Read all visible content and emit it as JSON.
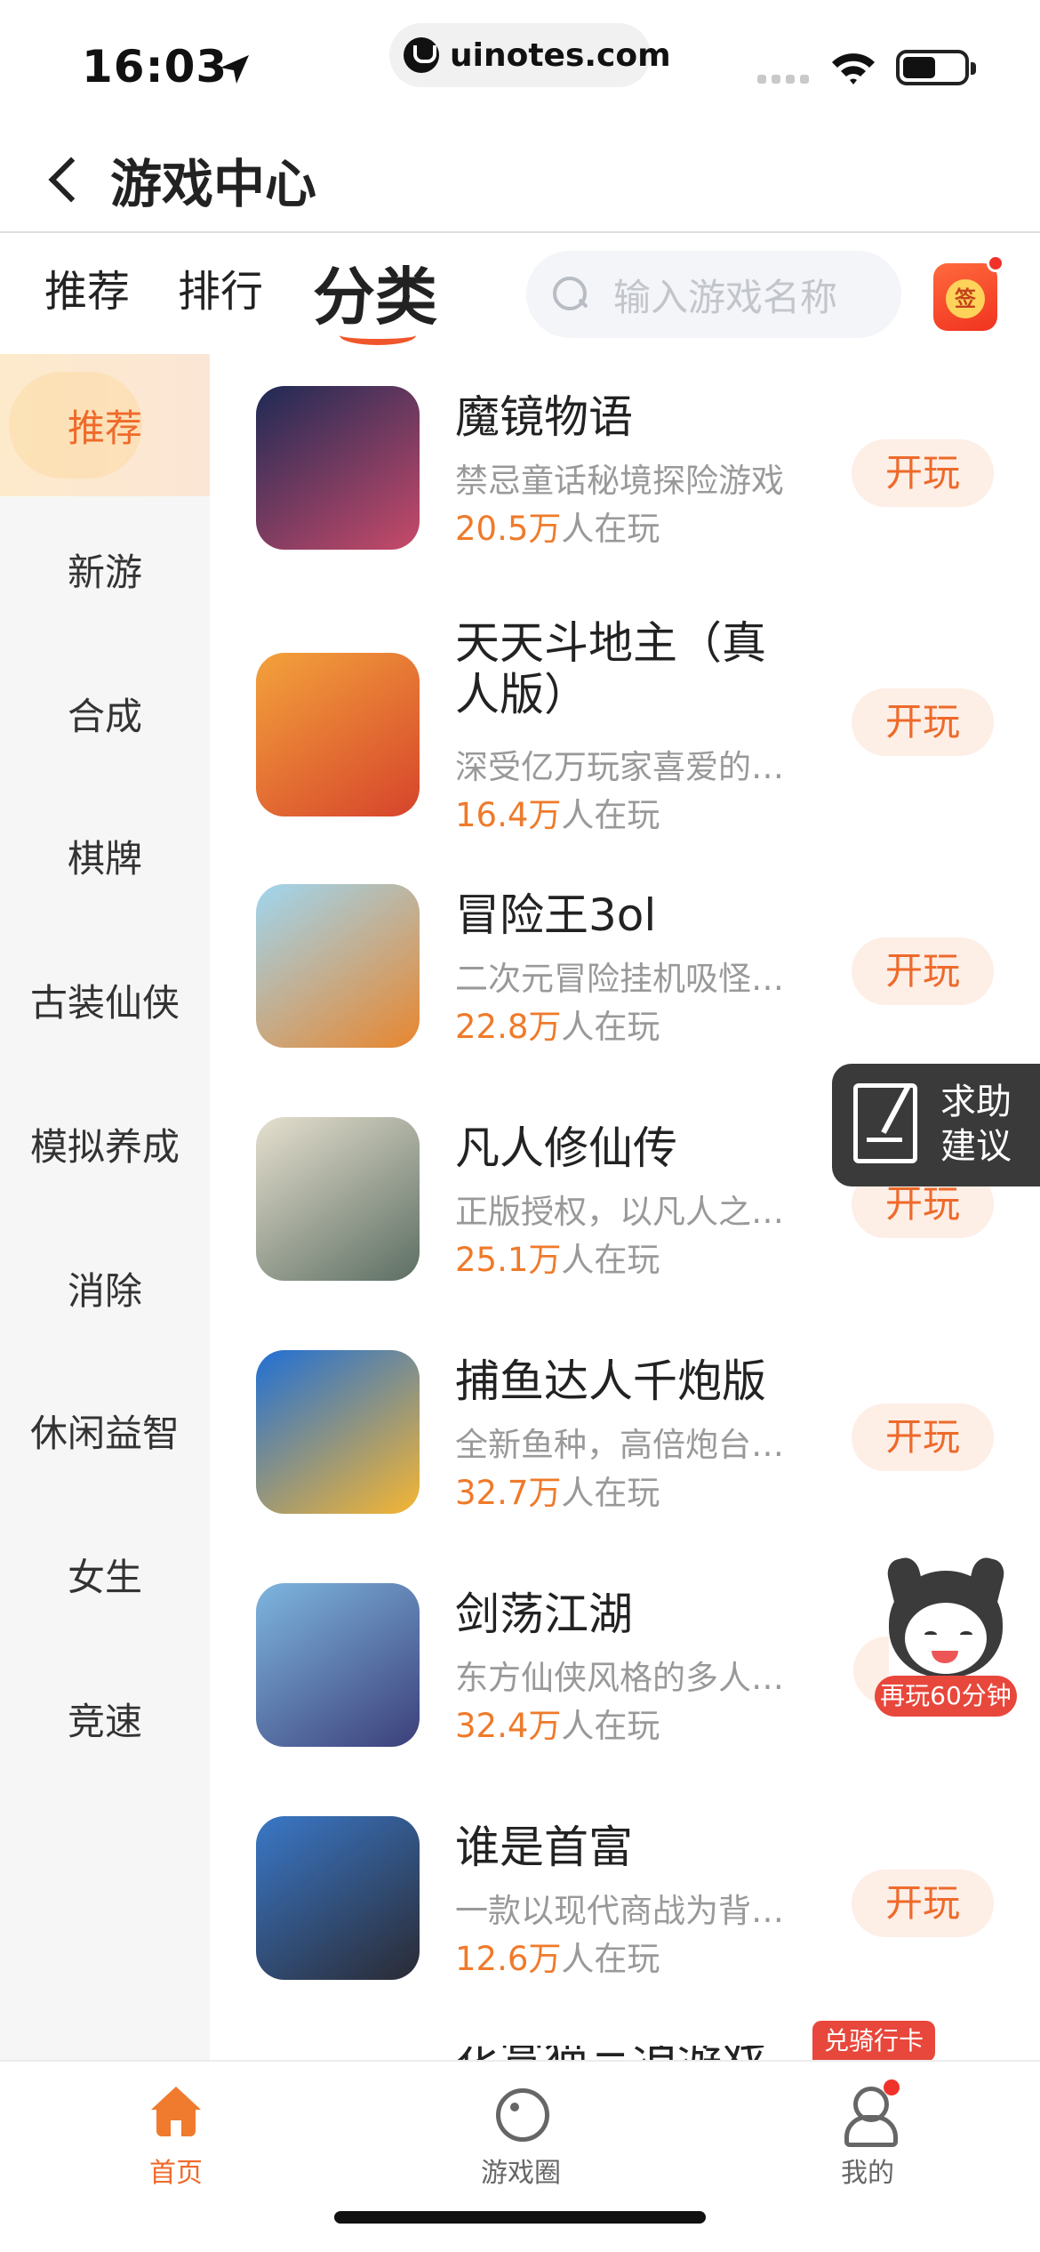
{
  "status_bar": {
    "time": "16:03",
    "url": "uinotes.com"
  },
  "nav": {
    "title": "游戏中心"
  },
  "tabs": [
    {
      "label": "推荐",
      "active": false
    },
    {
      "label": "排行",
      "active": false
    },
    {
      "label": "分类",
      "active": true
    }
  ],
  "search": {
    "placeholder": "输入游戏名称"
  },
  "sign": {
    "label": "签"
  },
  "sidebar": {
    "items": [
      {
        "label": "推荐",
        "active": true
      },
      {
        "label": "新游"
      },
      {
        "label": "合成"
      },
      {
        "label": "棋牌"
      },
      {
        "label": "古装仙侠"
      },
      {
        "label": "模拟养成"
      },
      {
        "label": "消除"
      },
      {
        "label": "休闲益智"
      },
      {
        "label": "女生"
      },
      {
        "label": "竞速"
      }
    ]
  },
  "play_suffix": "人在玩",
  "games": [
    {
      "title": "魔镜物语",
      "desc": "禁忌童话秘境探险游戏",
      "players": "20.5万",
      "button": "开玩",
      "icon_colors": [
        "#1d2a55",
        "#c84a6a"
      ]
    },
    {
      "title": "天天斗地主（真人版）",
      "desc": "深受亿万玩家喜爱的斗地主游戏",
      "players": "16.4万",
      "button": "开玩",
      "icon_colors": [
        "#f3a23c",
        "#d6442b"
      ]
    },
    {
      "title": "冒险王3ol",
      "desc": "二次元冒险挂机吸怪游戏",
      "players": "22.8万",
      "button": "开玩",
      "icon_colors": [
        "#9fd6f0",
        "#e8862e"
      ]
    },
    {
      "title": "凡人修仙传",
      "desc": "正版授权，以凡人之躯修仙",
      "players": "25.1万",
      "button": "开玩",
      "icon_colors": [
        "#e6e0cf",
        "#5c6e63"
      ]
    },
    {
      "title": "捕鱼达人千炮版",
      "desc": "全新鱼种，高倍炮台等你来",
      "players": "32.7万",
      "button": "开玩",
      "icon_colors": [
        "#1f6fd6",
        "#f6b632"
      ]
    },
    {
      "title": "剑荡江湖",
      "desc": "东方仙侠风格的多人在线游戏",
      "players": "32.4万",
      "button": "开玩",
      "icon_colors": [
        "#7eb6e0",
        "#3c3f7a"
      ]
    },
    {
      "title": "谁是首富",
      "desc": "一款以现代商战为背景的游戏",
      "players": "12.6万",
      "button": "开玩",
      "icon_colors": [
        "#3a78c8",
        "#2a2a33"
      ]
    }
  ],
  "help_float": {
    "line1": "求助",
    "line2": "建议"
  },
  "mascot": {
    "badge": "再玩60分钟"
  },
  "card_tag": "兑骑行卡",
  "partial_title": "花赏猫三消游戏",
  "bottom_nav": [
    {
      "label": "首页",
      "active": true
    },
    {
      "label": "游戏圈",
      "active": false
    },
    {
      "label": "我的",
      "active": false
    }
  ],
  "colors": {
    "accent": "#ef6a2a",
    "badge_red": "#e8473c"
  }
}
